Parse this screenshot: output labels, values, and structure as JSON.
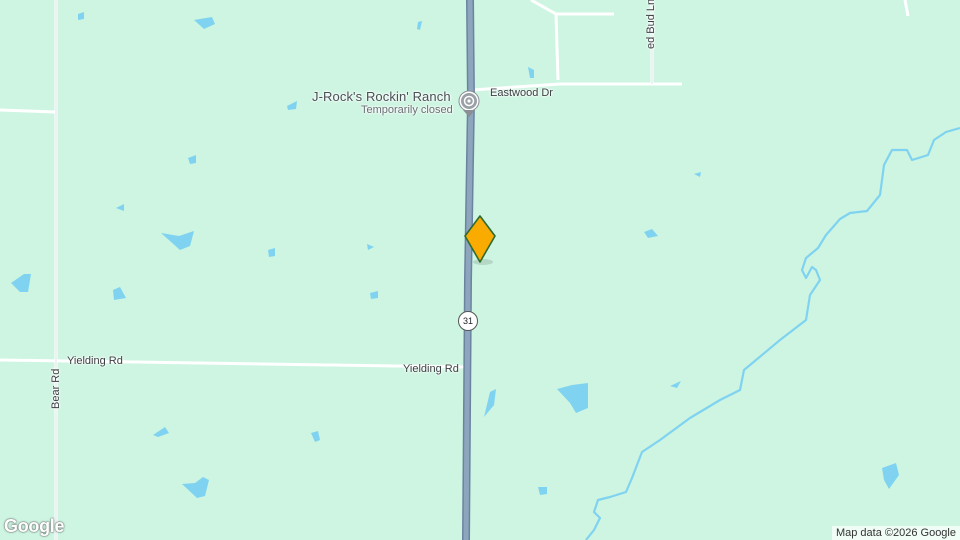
{
  "map": {
    "colors": {
      "land": "#cdf5e2",
      "water": "#7fd3f0",
      "highway": "#8299b0",
      "minor_road": "#ffffff",
      "marker_fill": "#f9ab00",
      "marker_stroke": "#2e6b2e"
    },
    "poi": {
      "name": "J-Rock's Rockin' Ranch",
      "status": "Temporarily closed",
      "icon": "ranch-pin-icon"
    },
    "roads": {
      "eastwood": "Eastwood Dr",
      "red_bud": "ed Bud Ln",
      "yielding_west": "Yielding Rd",
      "yielding_east": "Yielding Rd",
      "bear": "Bear Rd",
      "highway_shield": "31"
    },
    "marker": {
      "icon": "location-diamond-icon"
    },
    "attribution": "Map data ©2026 Google",
    "logo": "Google"
  }
}
